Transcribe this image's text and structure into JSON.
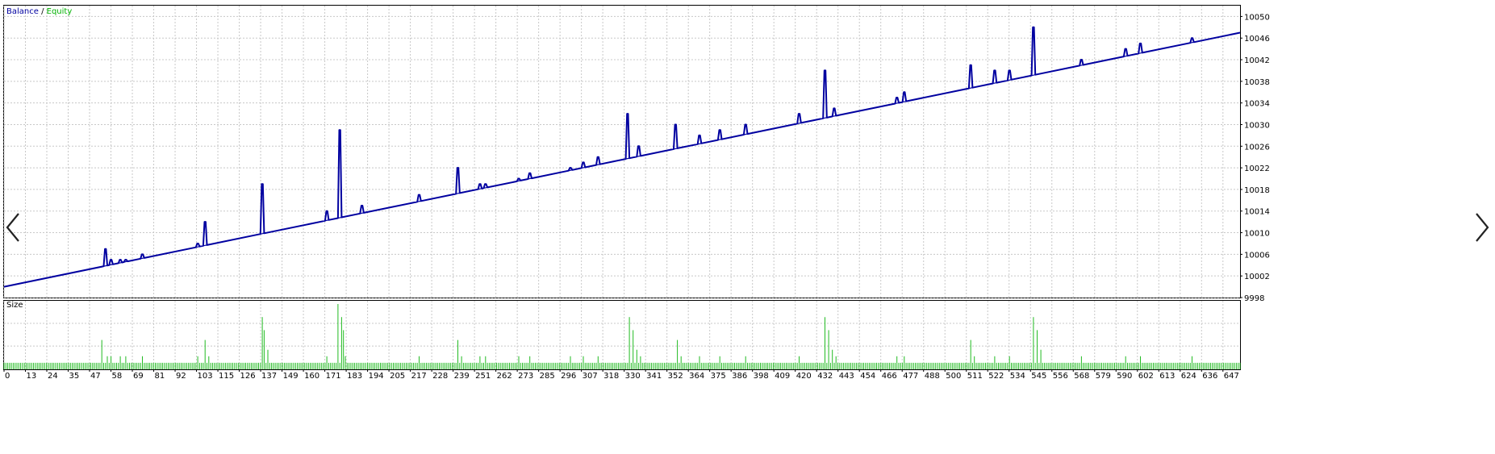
{
  "main_panel": {
    "legend": {
      "balance_label": "Balance",
      "separator": " / ",
      "equity_label": "Equity",
      "balance_color": "#0000a0",
      "equity_color": "#00b000"
    },
    "y_ticks": [
      "10050",
      "10046",
      "10042",
      "10038",
      "10034",
      "10030",
      "10026",
      "10022",
      "10018",
      "10014",
      "10010",
      "10006",
      "10002",
      "9998"
    ]
  },
  "size_panel": {
    "title": "Size",
    "bar_color": "#22bb22"
  },
  "x_ticks": [
    "0",
    "13",
    "24",
    "35",
    "47",
    "58",
    "69",
    "81",
    "92",
    "103",
    "115",
    "126",
    "137",
    "149",
    "160",
    "171",
    "183",
    "194",
    "205",
    "217",
    "228",
    "239",
    "251",
    "262",
    "273",
    "285",
    "296",
    "307",
    "318",
    "330",
    "341",
    "352",
    "364",
    "375",
    "386",
    "398",
    "409",
    "420",
    "432",
    "443",
    "454",
    "466",
    "477",
    "488",
    "500",
    "511",
    "522",
    "534",
    "545",
    "556",
    "568",
    "579",
    "590",
    "602",
    "613",
    "624",
    "636",
    "647"
  ],
  "nav": {
    "prev_icon": "chevron-left-icon",
    "next_icon": "chevron-right-icon"
  },
  "chart_data": {
    "type": "line",
    "series": [
      {
        "name": "Balance",
        "color": "#0000a0",
        "x": [
          0,
          670
        ],
        "y": [
          10000,
          10047
        ]
      },
      {
        "name": "Equity",
        "color": "#0000a0",
        "spikes": [
          {
            "x": 55,
            "peak": 10007
          },
          {
            "x": 58,
            "peak": 10005
          },
          {
            "x": 63,
            "peak": 10005
          },
          {
            "x": 66,
            "peak": 10005
          },
          {
            "x": 75,
            "peak": 10006
          },
          {
            "x": 105,
            "peak": 10008
          },
          {
            "x": 109,
            "peak": 10012
          },
          {
            "x": 140,
            "peak": 10019
          },
          {
            "x": 175,
            "peak": 10014
          },
          {
            "x": 182,
            "peak": 10029
          },
          {
            "x": 194,
            "peak": 10015
          },
          {
            "x": 225,
            "peak": 10017
          },
          {
            "x": 246,
            "peak": 10022
          },
          {
            "x": 258,
            "peak": 10019
          },
          {
            "x": 261,
            "peak": 10019
          },
          {
            "x": 279,
            "peak": 10020
          },
          {
            "x": 285,
            "peak": 10021
          },
          {
            "x": 307,
            "peak": 10022
          },
          {
            "x": 314,
            "peak": 10023
          },
          {
            "x": 322,
            "peak": 10024
          },
          {
            "x": 338,
            "peak": 10032
          },
          {
            "x": 344,
            "peak": 10026
          },
          {
            "x": 364,
            "peak": 10030
          },
          {
            "x": 377,
            "peak": 10028
          },
          {
            "x": 388,
            "peak": 10029
          },
          {
            "x": 402,
            "peak": 10030
          },
          {
            "x": 431,
            "peak": 10032
          },
          {
            "x": 445,
            "peak": 10040
          },
          {
            "x": 450,
            "peak": 10033
          },
          {
            "x": 484,
            "peak": 10035
          },
          {
            "x": 488,
            "peak": 10036
          },
          {
            "x": 524,
            "peak": 10041
          },
          {
            "x": 537,
            "peak": 10040
          },
          {
            "x": 545,
            "peak": 10040
          },
          {
            "x": 558,
            "peak": 10048
          },
          {
            "x": 584,
            "peak": 10042
          },
          {
            "x": 608,
            "peak": 10044
          },
          {
            "x": 616,
            "peak": 10045
          },
          {
            "x": 644,
            "peak": 10046
          }
        ]
      }
    ],
    "size": {
      "base": 1,
      "max": 10,
      "spikes": [
        {
          "x": 53,
          "v": 4.5
        },
        {
          "x": 56,
          "v": 2
        },
        {
          "x": 58,
          "v": 2
        },
        {
          "x": 63,
          "v": 2
        },
        {
          "x": 66,
          "v": 2
        },
        {
          "x": 75,
          "v": 2
        },
        {
          "x": 105,
          "v": 2
        },
        {
          "x": 109,
          "v": 4.5
        },
        {
          "x": 111,
          "v": 2
        },
        {
          "x": 140,
          "v": 8
        },
        {
          "x": 141,
          "v": 6
        },
        {
          "x": 143,
          "v": 3
        },
        {
          "x": 175,
          "v": 2
        },
        {
          "x": 181,
          "v": 10
        },
        {
          "x": 183,
          "v": 8
        },
        {
          "x": 184,
          "v": 6
        },
        {
          "x": 185,
          "v": 2
        },
        {
          "x": 225,
          "v": 2
        },
        {
          "x": 246,
          "v": 4.5
        },
        {
          "x": 248,
          "v": 2
        },
        {
          "x": 258,
          "v": 2
        },
        {
          "x": 261,
          "v": 2
        },
        {
          "x": 279,
          "v": 2
        },
        {
          "x": 285,
          "v": 2
        },
        {
          "x": 307,
          "v": 2
        },
        {
          "x": 314,
          "v": 2
        },
        {
          "x": 322,
          "v": 2
        },
        {
          "x": 339,
          "v": 8
        },
        {
          "x": 341,
          "v": 6
        },
        {
          "x": 343,
          "v": 3
        },
        {
          "x": 345,
          "v": 2
        },
        {
          "x": 365,
          "v": 4.5
        },
        {
          "x": 367,
          "v": 2
        },
        {
          "x": 377,
          "v": 2
        },
        {
          "x": 388,
          "v": 2
        },
        {
          "x": 402,
          "v": 2
        },
        {
          "x": 431,
          "v": 2
        },
        {
          "x": 445,
          "v": 8
        },
        {
          "x": 447,
          "v": 6
        },
        {
          "x": 449,
          "v": 3
        },
        {
          "x": 451,
          "v": 2
        },
        {
          "x": 484,
          "v": 2
        },
        {
          "x": 488,
          "v": 2
        },
        {
          "x": 524,
          "v": 4.5
        },
        {
          "x": 526,
          "v": 2
        },
        {
          "x": 537,
          "v": 2
        },
        {
          "x": 545,
          "v": 2
        },
        {
          "x": 558,
          "v": 8
        },
        {
          "x": 560,
          "v": 6
        },
        {
          "x": 562,
          "v": 3
        },
        {
          "x": 584,
          "v": 2
        },
        {
          "x": 608,
          "v": 2
        },
        {
          "x": 616,
          "v": 2
        },
        {
          "x": 644,
          "v": 2
        }
      ]
    },
    "xlim": [
      0,
      670
    ],
    "ylim": [
      9998,
      10052
    ],
    "grid": true
  }
}
